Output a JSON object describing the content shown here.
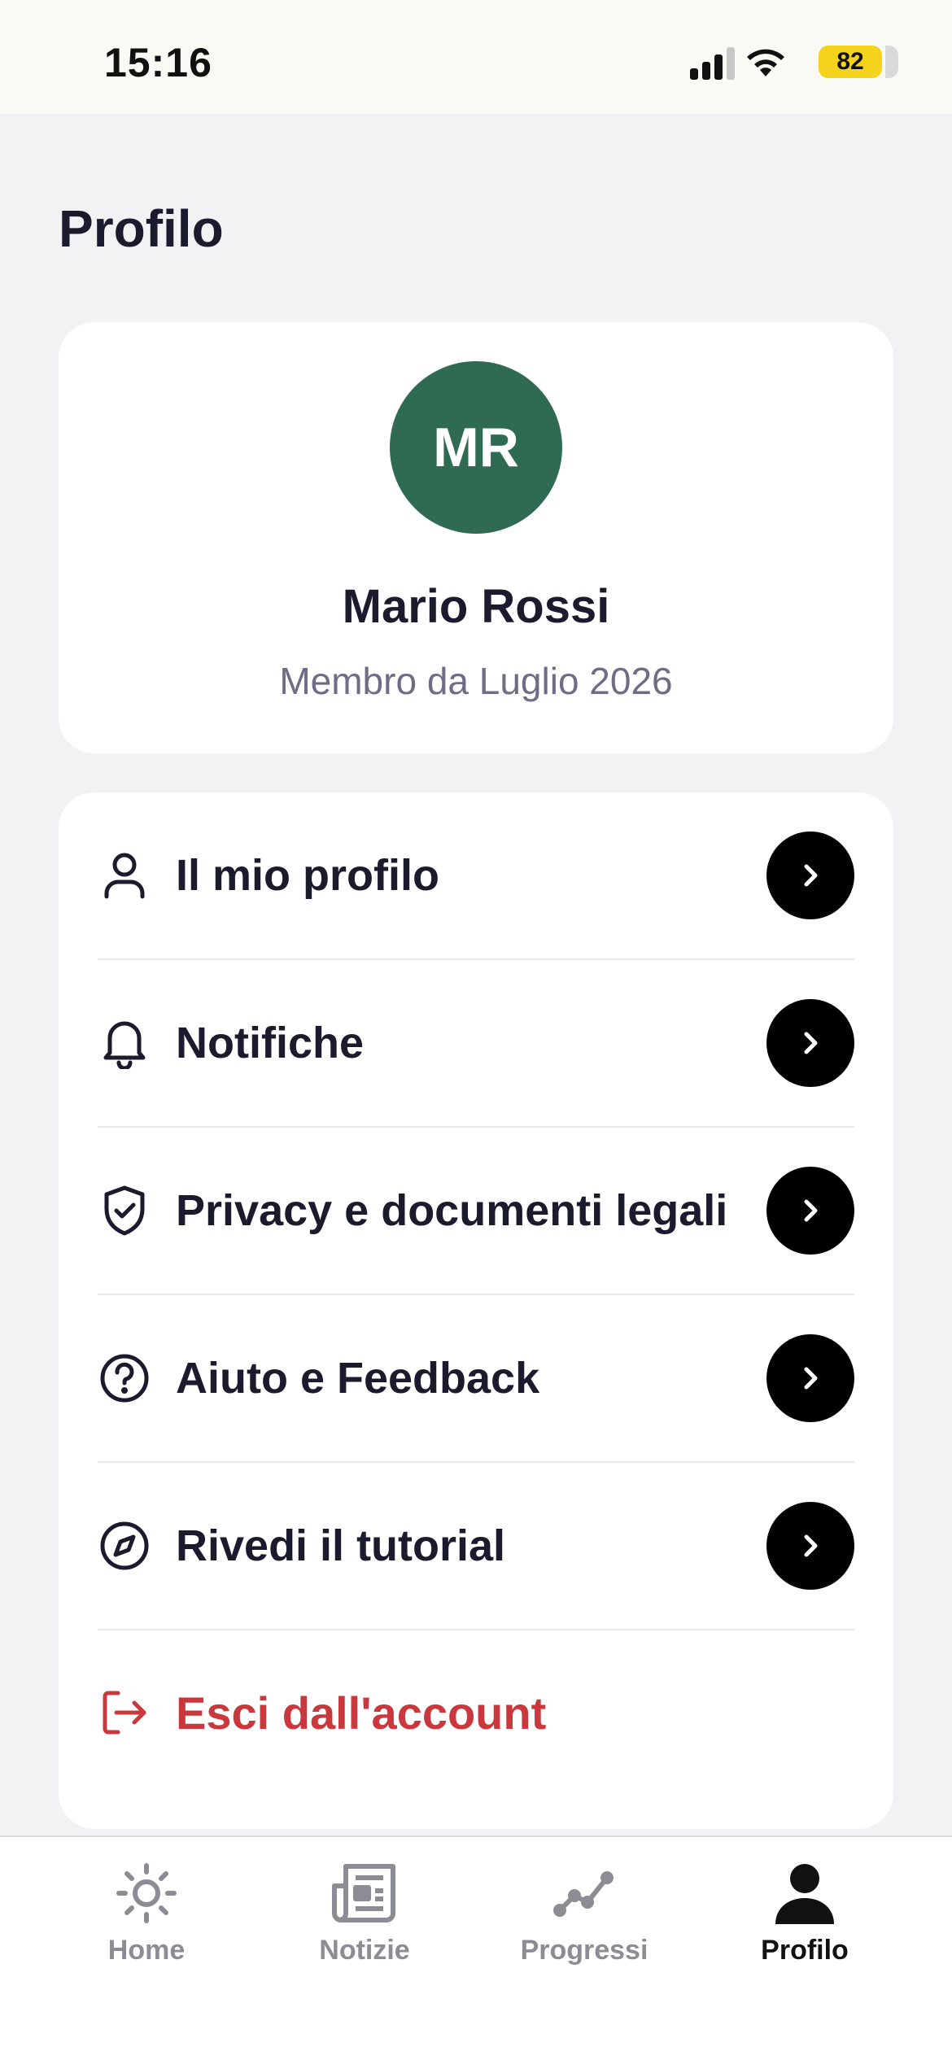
{
  "status_bar": {
    "time": "15:16",
    "battery": "82"
  },
  "page": {
    "title": "Profilo"
  },
  "profile": {
    "initials": "MR",
    "name": "Mario Rossi",
    "member_since": "Membro da Luglio 2026",
    "avatar_color": "#2e6b52"
  },
  "menu": {
    "items": [
      {
        "label": "Il mio profilo",
        "icon": "user-icon"
      },
      {
        "label": "Notifiche",
        "icon": "bell-icon"
      },
      {
        "label": "Privacy e documenti legali",
        "icon": "shield-check-icon"
      },
      {
        "label": "Aiuto e Feedback",
        "icon": "help-circle-icon"
      },
      {
        "label": "Rivedi il tutorial",
        "icon": "compass-icon"
      }
    ],
    "logout_label": "Esci dall'account",
    "logout_color": "#c9383d"
  },
  "tab_bar": {
    "tabs": [
      {
        "label": "Home",
        "icon": "sun-icon",
        "active": false
      },
      {
        "label": "Notizie",
        "icon": "newspaper-icon",
        "active": false
      },
      {
        "label": "Progressi",
        "icon": "trend-line-icon",
        "active": false
      },
      {
        "label": "Profilo",
        "icon": "person-icon",
        "active": true
      }
    ]
  }
}
